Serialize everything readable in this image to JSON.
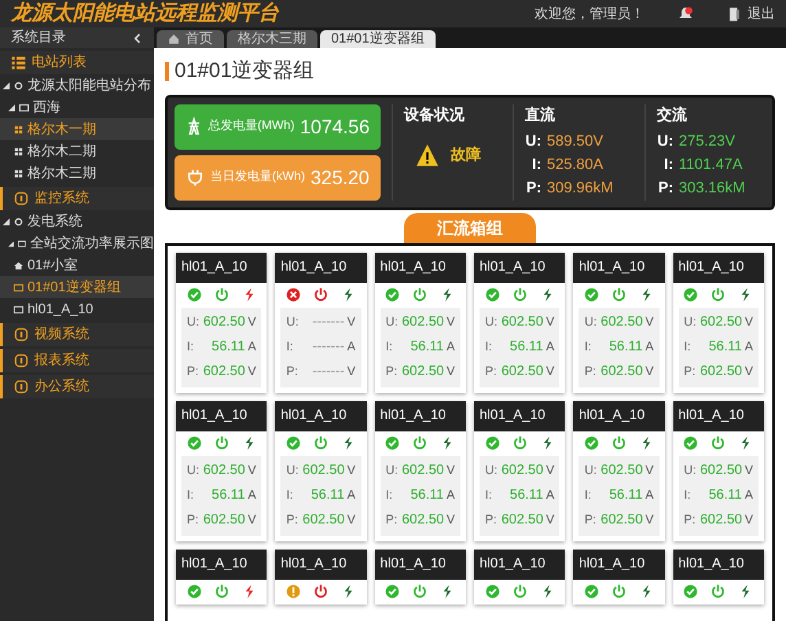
{
  "header": {
    "title": "龙源太阳能电站远程监测平台",
    "welcome": "欢迎您，管理员！",
    "logout": "退出"
  },
  "tabs": [
    {
      "label": "首页",
      "selected": false
    },
    {
      "label": "格尔木三期",
      "selected": false
    },
    {
      "label": "01#01逆变器组",
      "selected": true
    }
  ],
  "sidebar": {
    "title": "系统目录",
    "sections": [
      {
        "label": "电站列表",
        "active": true,
        "tree": [
          {
            "label": "龙源太阳能电站分布",
            "kind": "node",
            "expanded": true,
            "selected": false,
            "children": [
              {
                "label": "西海",
                "kind": "folder",
                "expanded": true,
                "selected": false,
                "children": [
                  {
                    "label": "格尔木一期",
                    "kind": "grid",
                    "selected": true
                  },
                  {
                    "label": "格尔木二期",
                    "kind": "grid",
                    "selected": false
                  },
                  {
                    "label": "格尔木三期",
                    "kind": "grid",
                    "selected": false
                  }
                ]
              }
            ]
          }
        ]
      },
      {
        "label": "监控系统",
        "active": false,
        "tree": [
          {
            "label": "发电系统",
            "kind": "node",
            "expanded": true,
            "selected": false,
            "children": [
              {
                "label": "全站交流功率展示图",
                "kind": "folder",
                "expanded": true,
                "selected": false,
                "children": [
                  {
                    "label": "01#小室",
                    "kind": "home",
                    "selected": false
                  },
                  {
                    "label": "01#01逆变器组",
                    "kind": "folder",
                    "selected": true
                  },
                  {
                    "label": "hl01_A_10",
                    "kind": "folder",
                    "selected": false
                  }
                ]
              }
            ]
          }
        ]
      },
      {
        "label": "视频系统",
        "active": false
      },
      {
        "label": "报表系统",
        "active": false
      },
      {
        "label": "办公系统",
        "active": false
      }
    ]
  },
  "page_title": "01#01逆变器组",
  "summary": {
    "total": {
      "label": "总发电量(MWh)",
      "value": "1074.56"
    },
    "today": {
      "label": "当日发电量(kWh)",
      "value": "325.20"
    },
    "status": {
      "title": "设备状况",
      "kind": "fault",
      "label": "故障"
    },
    "dc": {
      "title": "直流",
      "rows": [
        {
          "key": "U:",
          "value": "589.50V"
        },
        {
          "key": "I:",
          "value": "525.80A"
        },
        {
          "key": "P:",
          "value": "309.96kM"
        }
      ]
    },
    "ac": {
      "title": "交流",
      "rows": [
        {
          "key": "U:",
          "value": "275.23V"
        },
        {
          "key": "I:",
          "value": "1101.47A"
        },
        {
          "key": "P:",
          "value": "303.16kM"
        }
      ]
    }
  },
  "group_title": "汇流箱组",
  "boxes": [
    {
      "name": "hl01_A_10",
      "kind": "ok",
      "power_on": true,
      "alarm": true,
      "values": [
        {
          "key": "U:",
          "value": "602.50",
          "unit": "V"
        },
        {
          "key": "I:",
          "value": "56.11",
          "unit": "A"
        },
        {
          "key": "P:",
          "value": "602.50",
          "unit": "V"
        }
      ]
    },
    {
      "name": "hl01_A_10",
      "kind": "fault",
      "power_on": false,
      "alarm": false,
      "values": [
        {
          "key": "U:",
          "value": "-------",
          "unit": "V"
        },
        {
          "key": "I:",
          "value": "-------",
          "unit": "A"
        },
        {
          "key": "P:",
          "value": "-------",
          "unit": "V"
        }
      ]
    },
    {
      "name": "hl01_A_10",
      "kind": "ok",
      "power_on": true,
      "alarm": false,
      "values": [
        {
          "key": "U:",
          "value": "602.50",
          "unit": "V"
        },
        {
          "key": "I:",
          "value": "56.11",
          "unit": "A"
        },
        {
          "key": "P:",
          "value": "602.50",
          "unit": "V"
        }
      ]
    },
    {
      "name": "hl01_A_10",
      "kind": "ok",
      "power_on": true,
      "alarm": false,
      "values": [
        {
          "key": "U:",
          "value": "602.50",
          "unit": "V"
        },
        {
          "key": "I:",
          "value": "56.11",
          "unit": "A"
        },
        {
          "key": "P:",
          "value": "602.50",
          "unit": "V"
        }
      ]
    },
    {
      "name": "hl01_A_10",
      "kind": "ok",
      "power_on": true,
      "alarm": false,
      "values": [
        {
          "key": "U:",
          "value": "602.50",
          "unit": "V"
        },
        {
          "key": "I:",
          "value": "56.11",
          "unit": "A"
        },
        {
          "key": "P:",
          "value": "602.50",
          "unit": "V"
        }
      ]
    },
    {
      "name": "hl01_A_10",
      "kind": "ok",
      "power_on": true,
      "alarm": false,
      "values": [
        {
          "key": "U:",
          "value": "602.50",
          "unit": "V"
        },
        {
          "key": "I:",
          "value": "56.11",
          "unit": "A"
        },
        {
          "key": "P:",
          "value": "602.50",
          "unit": "V"
        }
      ]
    },
    {
      "name": "hl01_A_10",
      "kind": "ok",
      "power_on": true,
      "alarm": false,
      "values": [
        {
          "key": "U:",
          "value": "602.50",
          "unit": "V"
        },
        {
          "key": "I:",
          "value": "56.11",
          "unit": "A"
        },
        {
          "key": "P:",
          "value": "602.50",
          "unit": "V"
        }
      ]
    },
    {
      "name": "hl01_A_10",
      "kind": "ok",
      "power_on": true,
      "alarm": false,
      "values": [
        {
          "key": "U:",
          "value": "602.50",
          "unit": "V"
        },
        {
          "key": "I:",
          "value": "56.11",
          "unit": "A"
        },
        {
          "key": "P:",
          "value": "602.50",
          "unit": "V"
        }
      ]
    },
    {
      "name": "hl01_A_10",
      "kind": "ok",
      "power_on": true,
      "alarm": false,
      "values": [
        {
          "key": "U:",
          "value": "602.50",
          "unit": "V"
        },
        {
          "key": "I:",
          "value": "56.11",
          "unit": "A"
        },
        {
          "key": "P:",
          "value": "602.50",
          "unit": "V"
        }
      ]
    },
    {
      "name": "hl01_A_10",
      "kind": "ok",
      "power_on": true,
      "alarm": false,
      "values": [
        {
          "key": "U:",
          "value": "602.50",
          "unit": "V"
        },
        {
          "key": "I:",
          "value": "56.11",
          "unit": "A"
        },
        {
          "key": "P:",
          "value": "602.50",
          "unit": "V"
        }
      ]
    },
    {
      "name": "hl01_A_10",
      "kind": "ok",
      "power_on": true,
      "alarm": false,
      "values": [
        {
          "key": "U:",
          "value": "602.50",
          "unit": "V"
        },
        {
          "key": "I:",
          "value": "56.11",
          "unit": "A"
        },
        {
          "key": "P:",
          "value": "602.50",
          "unit": "V"
        }
      ]
    },
    {
      "name": "hl01_A_10",
      "kind": "ok",
      "power_on": true,
      "alarm": false,
      "values": [
        {
          "key": "U:",
          "value": "602.50",
          "unit": "V"
        },
        {
          "key": "I:",
          "value": "56.11",
          "unit": "A"
        },
        {
          "key": "P:",
          "value": "602.50",
          "unit": "V"
        }
      ]
    },
    {
      "name": "hl01_A_10",
      "kind": "ok",
      "power_on": true,
      "alarm": true
    },
    {
      "name": "hl01_A_10",
      "kind": "warning",
      "power_on": false,
      "alarm": false
    },
    {
      "name": "hl01_A_10",
      "kind": "ok",
      "power_on": true,
      "alarm": false
    },
    {
      "name": "hl01_A_10",
      "kind": "ok",
      "power_on": true,
      "alarm": false
    },
    {
      "name": "hl01_A_10",
      "kind": "ok",
      "power_on": true,
      "alarm": false
    },
    {
      "name": "hl01_A_10",
      "kind": "ok",
      "power_on": true,
      "alarm": false
    }
  ]
}
